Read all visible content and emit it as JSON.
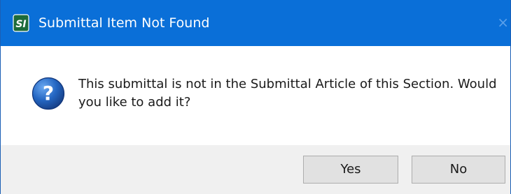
{
  "window": {
    "title": "Submittal Item Not Found",
    "app_icon": "si-logo-icon",
    "close_glyph": "×"
  },
  "message": {
    "icon": "question-icon",
    "text": "This submittal is not in the Submittal Article of this Section.  Would you like to add it?"
  },
  "buttons": {
    "yes_label": "Yes",
    "no_label": "No"
  },
  "colors": {
    "titlebar": "#0a6fd8",
    "footer": "#f0f0f0",
    "question_icon": "#1f5fb8",
    "app_icon_bg": "#1d6b3a"
  }
}
